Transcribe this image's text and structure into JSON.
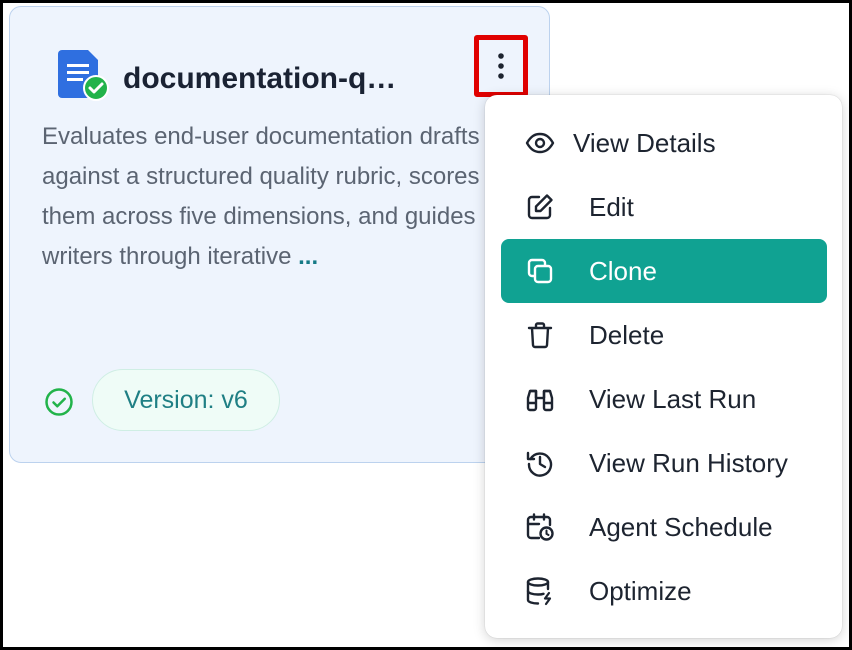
{
  "card": {
    "title": "documentation-q…",
    "description": "Evaluates end-user documentation drafts against a structured quality rubric, scores them across five dimensions, and guides writers through iterative ",
    "more_label": "...",
    "version_label": "Version: v6",
    "icons": {
      "document": "document-check-icon",
      "more": "more-vertical-icon",
      "status": "check-circle-icon"
    }
  },
  "menu": {
    "items": [
      {
        "label": "View Details",
        "icon": "eye-icon"
      },
      {
        "label": "Edit",
        "icon": "edit-icon"
      },
      {
        "label": "Clone",
        "icon": "copy-icon",
        "active": true
      },
      {
        "label": "Delete",
        "icon": "trash-icon"
      },
      {
        "label": "View Last Run",
        "icon": "binoculars-icon"
      },
      {
        "label": "View Run History",
        "icon": "history-icon"
      },
      {
        "label": "Agent Schedule",
        "icon": "calendar-clock-icon"
      },
      {
        "label": "Optimize",
        "icon": "database-bolt-icon"
      }
    ]
  },
  "colors": {
    "card_background": "#eef4fd",
    "accent": "#10a292",
    "highlight_border": "#e00000",
    "doc_icon": "#2f6fe0",
    "check_green": "#22b34a",
    "version_text": "#1f7f84"
  }
}
